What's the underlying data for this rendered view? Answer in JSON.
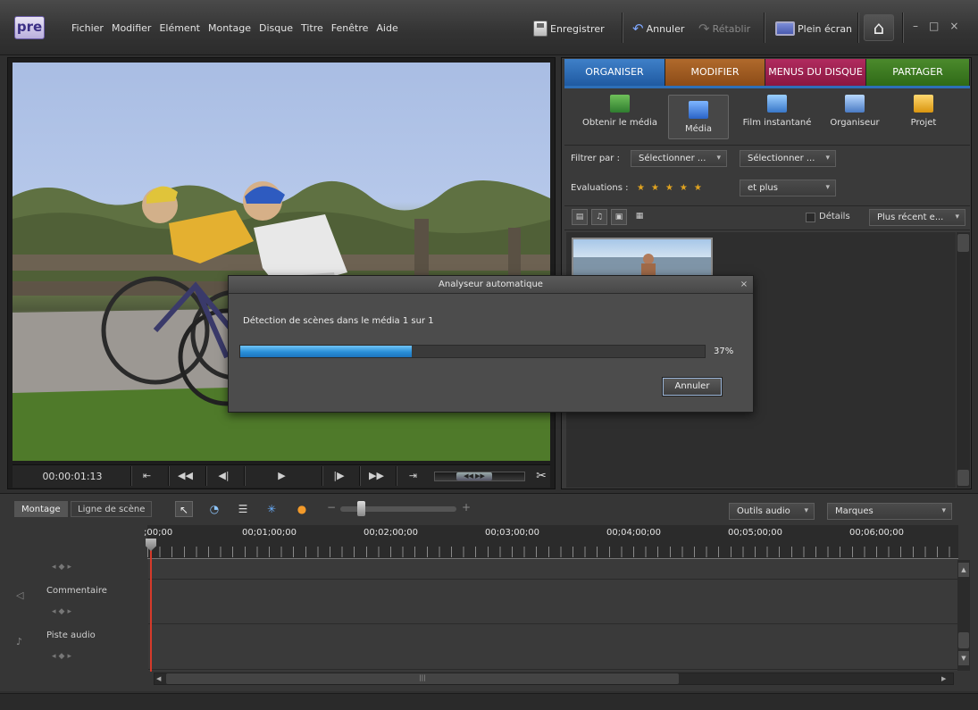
{
  "app": {
    "logo_text": "pre"
  },
  "menu": [
    "Fichier",
    "Modifier",
    "Elément",
    "Montage",
    "Disque",
    "Titre",
    "Fenêtre",
    "Aide"
  ],
  "toolbar": {
    "save": "Enregistrer",
    "undo": "Annuler",
    "redo": "Rétablir",
    "fullscreen": "Plein écran"
  },
  "monitor": {
    "timecode": "00:00:01:13"
  },
  "tabs": [
    "ORGANISER",
    "MODIFIER",
    "MENUS DU DISQUE",
    "PARTAGER"
  ],
  "organizer_tools": [
    "Obtenir le média",
    "Média",
    "Film instantané",
    "Organiseur",
    "Projet"
  ],
  "filters": {
    "filter_label": "Filtrer par :",
    "filter1": "Sélectionner ...",
    "filter2": "Sélectionner ...",
    "ratings_label": "Evaluations :",
    "ratings_value": "et plus"
  },
  "view": {
    "details_label": "Détails",
    "sort": "Plus récent e..."
  },
  "timeline": {
    "tab_montage": "Montage",
    "tab_scene": "Ligne de scène",
    "audio_tools": "Outils audio",
    "markers": "Marques",
    "ruler_labels": [
      ";00;00",
      "00;01;00;00",
      "00;02;00;00",
      "00;03;00;00",
      "00;04;00;00",
      "00;05;00;00",
      "00;06;00;00"
    ],
    "tracks": [
      "Commentaire",
      "Piste audio"
    ]
  },
  "dialog": {
    "title": "Analyseur automatique",
    "message": "Détection de scènes dans le média 1 sur 1",
    "progress": 0.37,
    "progress_text": "37%",
    "cancel": "Annuler"
  },
  "colors": {
    "organiser": "#2d6fb8",
    "modifier": "#9a5620",
    "menus": "#9e2050",
    "partager": "#3d7a22",
    "progress": "#2a8fd8",
    "playhead": "#d63a2a"
  }
}
